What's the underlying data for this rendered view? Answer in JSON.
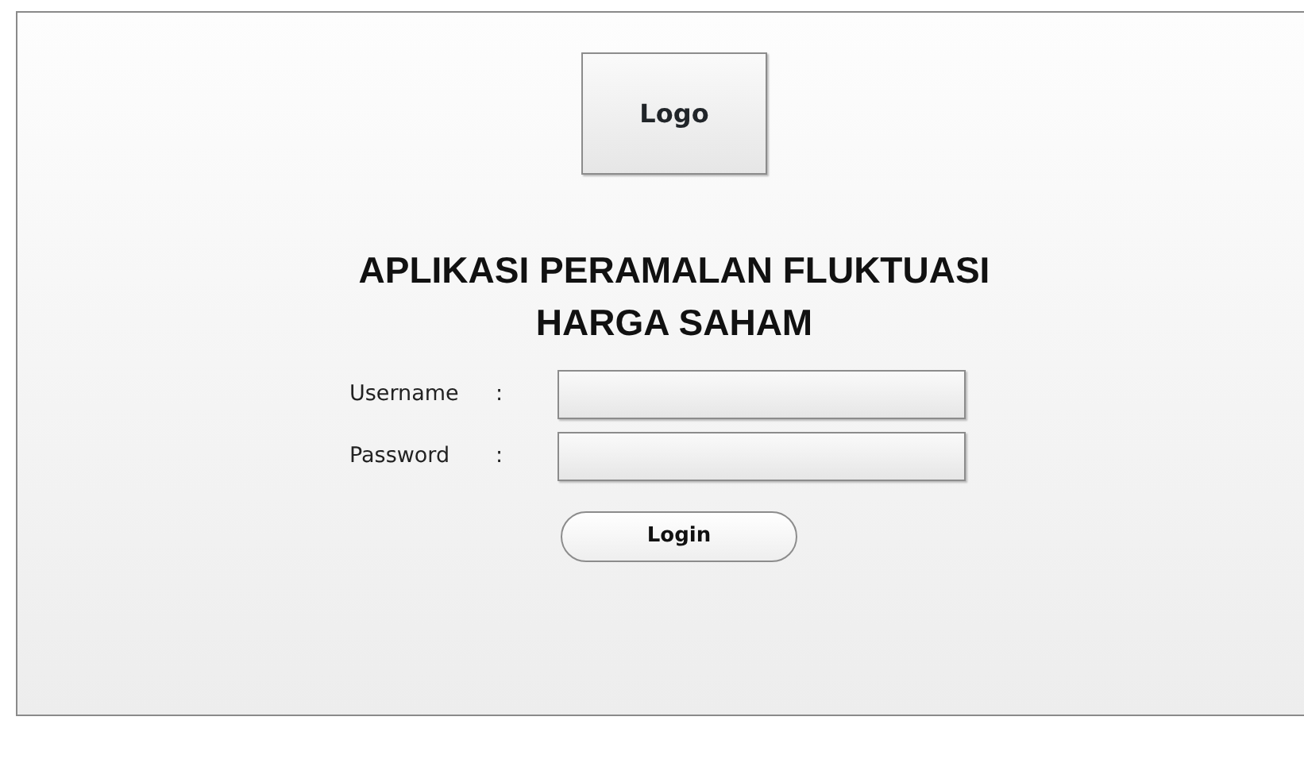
{
  "logo": {
    "label": "Logo"
  },
  "title": "APLIKASI PERAMALAN FLUKTUASI HARGA SAHAM",
  "fields": [
    {
      "label": "Username",
      "separator": ":"
    },
    {
      "label": "Password",
      "separator": ":"
    }
  ],
  "button": {
    "label": "Login"
  }
}
